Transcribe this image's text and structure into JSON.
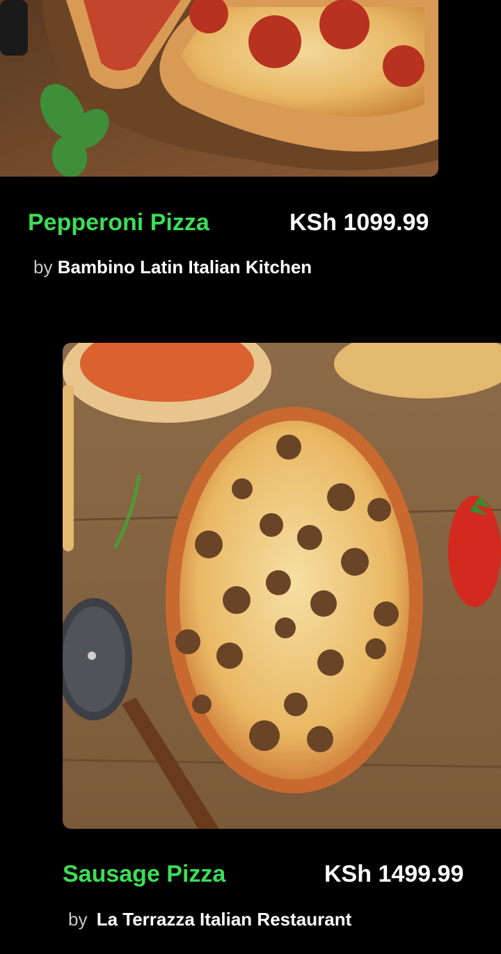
{
  "colors": {
    "background": "#000000",
    "accent": "#3ddc57",
    "text": "#ffffff",
    "muted": "#c8c8c8"
  },
  "items": [
    {
      "name": "Pepperoni Pizza",
      "price": "KSh 1099.99",
      "by": "by",
      "restaurant": "Bambino Latin Italian Kitchen",
      "image": "pepperoni-pizza-photo"
    },
    {
      "name": "Sausage Pizza",
      "price": "KSh 1499.99",
      "by": "by",
      "restaurant": "La Terrazza Italian Restaurant",
      "image": "sausage-pizza-photo"
    }
  ]
}
